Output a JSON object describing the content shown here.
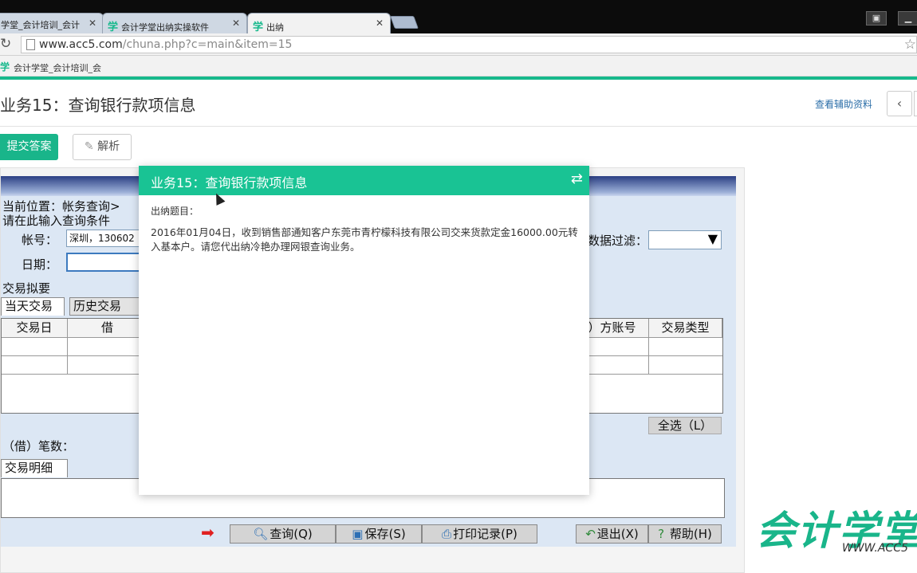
{
  "browser": {
    "tabs": [
      {
        "label": "学堂_会计培训_会计"
      },
      {
        "label": "会计学堂出纳实操软件"
      },
      {
        "label": "出纳"
      }
    ],
    "tab_logo": "学",
    "url_host": "www.acc5.com",
    "url_path": "/chuna.php?c=main&item=15",
    "bookmark_label": "会计学堂_会计培训_会"
  },
  "page": {
    "title": "业务15：查询银行款项信息",
    "aux_link": "查看辅助资料",
    "submit_label": "提交答案",
    "analyze_label": "解析"
  },
  "app": {
    "location": "当前位置：帐务查询>",
    "query_prompt": "请在此输入查询条件",
    "account_label": "帐号：",
    "account_value": "深圳，130602",
    "date_label": "日期：",
    "filter_label": "数据过滤：",
    "summary_label": "交易拟要",
    "tabs": [
      "当天交易",
      "历史交易"
    ],
    "columns": {
      "date": "交易日",
      "debit": "借",
      "counter_account": "）方账号",
      "type": "交易类型"
    },
    "select_all": "全选（L）",
    "debit_count_label": "（借）笔数：",
    "detail_tab": "交易明细",
    "buttons": {
      "query": "查询(Q)",
      "save": "保存(S)",
      "print": "打印记录(P)",
      "exit": "退出(X)",
      "help": "帮助(H)"
    }
  },
  "modal": {
    "title": "业务15：查询银行款项信息",
    "label": "出纳题目：",
    "text": "2016年01月04日，收到销售部通知客户东莞市青柠檬科技有限公司交来货款定金16000.00元转入基本户。请您代出纳冷艳办理网银查询业务。"
  },
  "watermark": {
    "cn": "会计学堂",
    "en": "WWW.ACC5"
  },
  "colors": {
    "accent": "#19b58a",
    "modal_header": "#19c394",
    "link": "#2b6ea8"
  }
}
